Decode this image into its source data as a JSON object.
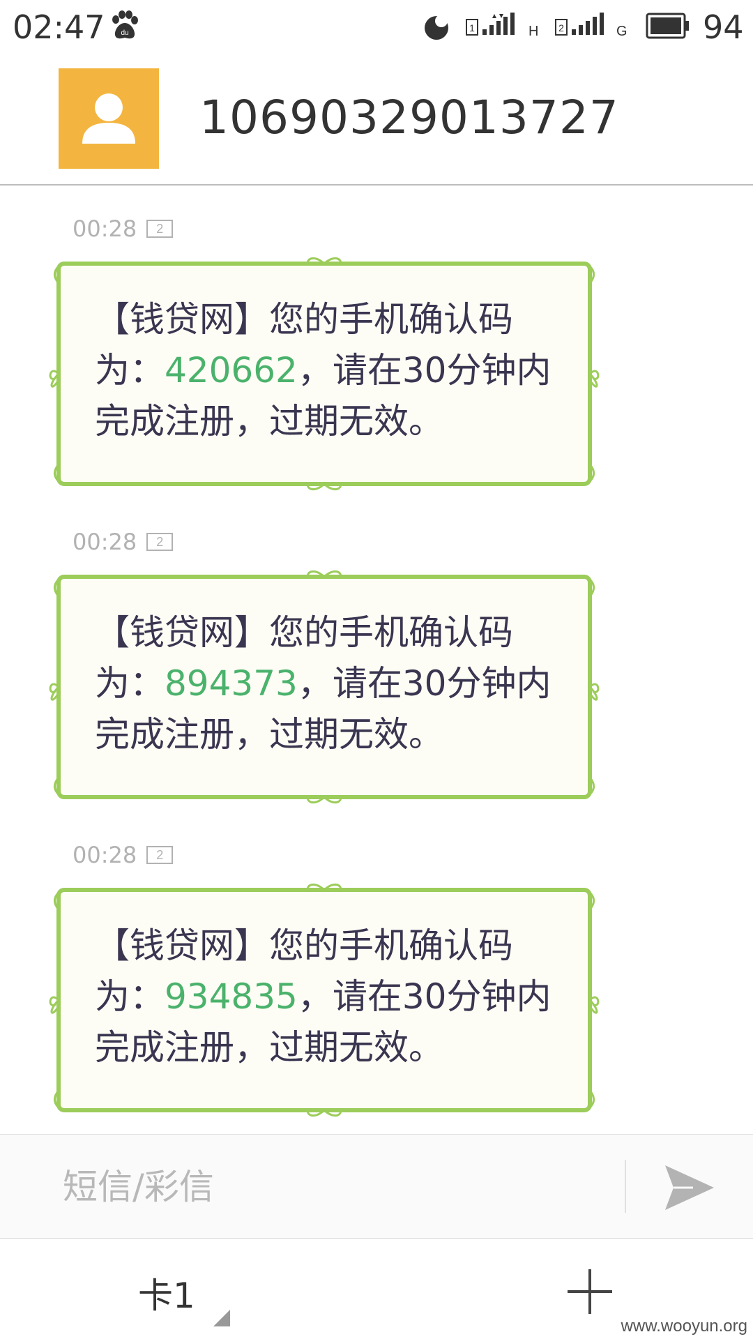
{
  "status_bar": {
    "time": "02:47",
    "battery": "94",
    "network1": "H",
    "network2": "G"
  },
  "header": {
    "contact_number": "10690329013727"
  },
  "messages": [
    {
      "time": "00:28",
      "sim": "2",
      "text_before": "【钱贷网】您的手机确认码为：",
      "code": "420662",
      "text_after": "，请在30分钟内完成注册，过期无效。"
    },
    {
      "time": "00:28",
      "sim": "2",
      "text_before": "【钱贷网】您的手机确认码为：",
      "code": "894373",
      "text_after": "，请在30分钟内完成注册，过期无效。"
    },
    {
      "time": "00:28",
      "sim": "2",
      "text_before": "【钱贷网】您的手机确认码为：",
      "code": "934835",
      "text_after": "，请在30分钟内完成注册，过期无效。"
    }
  ],
  "composer": {
    "placeholder": "短信/彩信"
  },
  "bottom_bar": {
    "sim_label": "卡1",
    "watermark": "www.wooyun.org"
  },
  "colors": {
    "avatar_bg": "#f3b53f",
    "code_green": "#4bb26c",
    "bubble_border": "#9ccc5a",
    "bubble_fill": "#fdfdf5"
  }
}
